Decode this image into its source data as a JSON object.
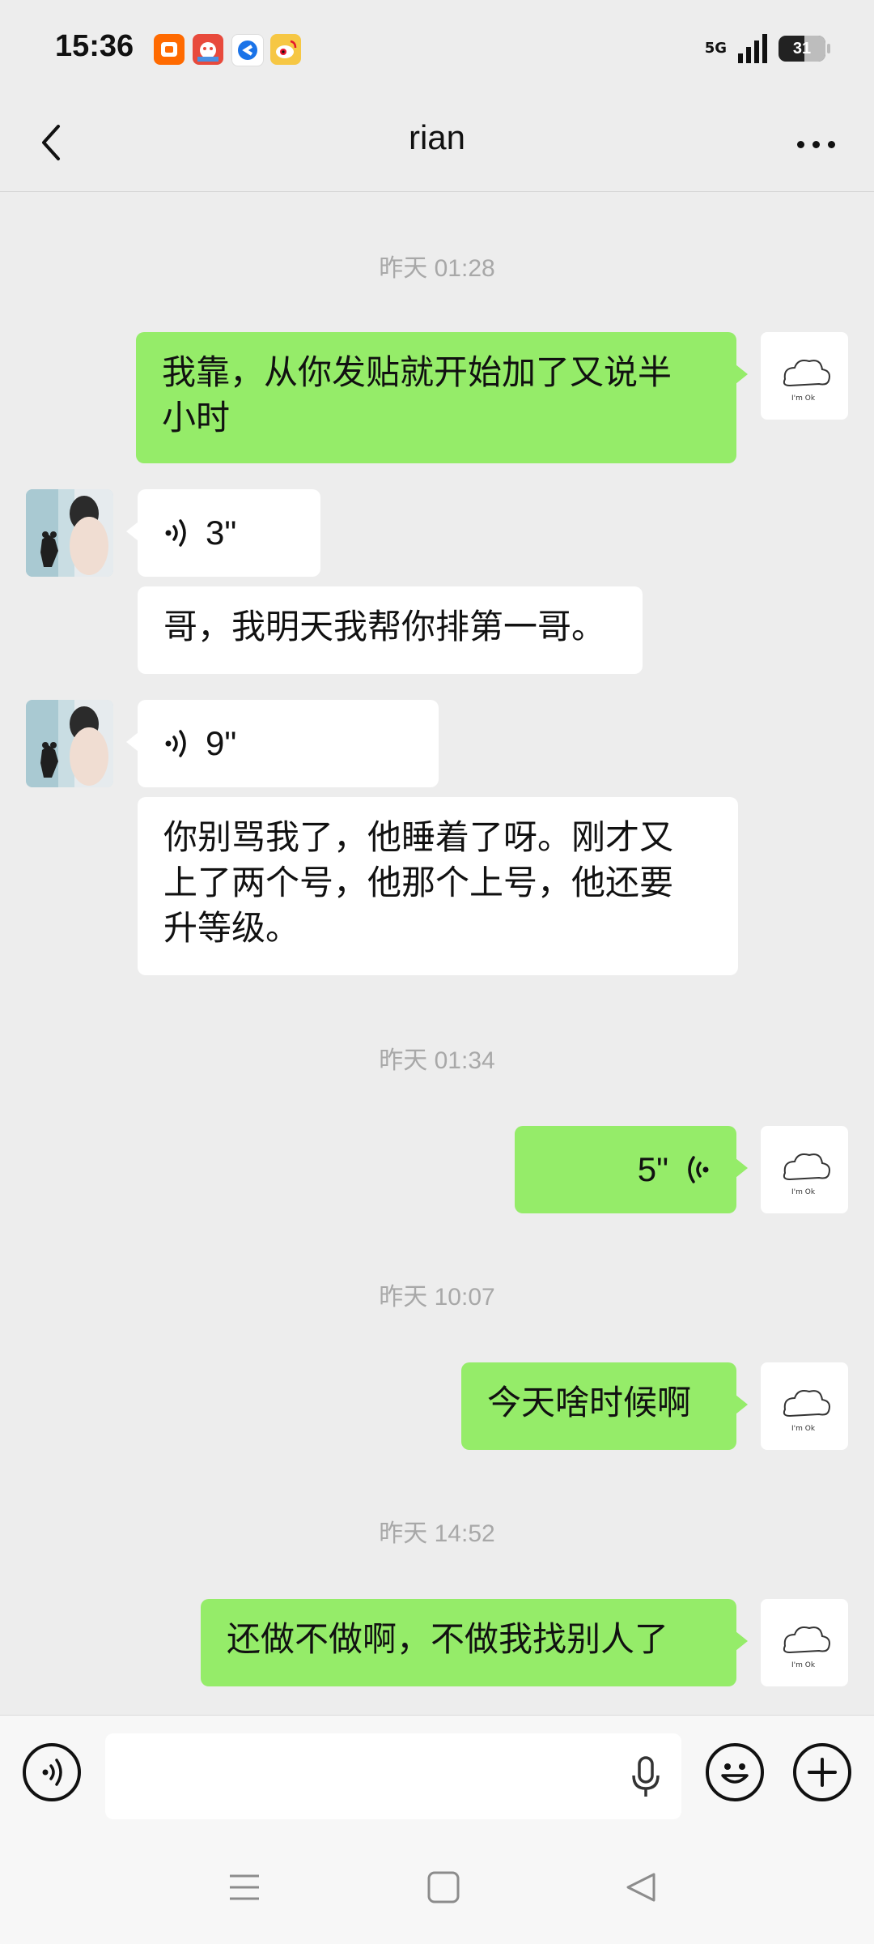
{
  "status_bar": {
    "time": "15:36",
    "network": "5G",
    "battery": "31",
    "notification_icons": [
      "taobao-icon",
      "game-icon",
      "browser-icon",
      "weibo-icon"
    ]
  },
  "header": {
    "title": "rian",
    "back_icon": "chevron-left-icon",
    "more_icon": "more-icon"
  },
  "contact_avatar_note": "",
  "my_avatar": {
    "caption": "I'm Ok"
  },
  "messages": [
    {
      "type": "timestamp",
      "text": "昨天 01:28"
    },
    {
      "type": "text",
      "from": "me",
      "lines": [
        "我靠，从你发贴就开始加了又说半",
        "小时"
      ]
    },
    {
      "type": "voice",
      "from": "them",
      "duration": "3\""
    },
    {
      "type": "text",
      "from": "them",
      "lines": [
        "哥，我明天我帮你排第一哥。"
      ]
    },
    {
      "type": "voice",
      "from": "them",
      "duration": "9\""
    },
    {
      "type": "text",
      "from": "them",
      "lines": [
        "你别骂我了，他睡着了呀。刚才又",
        "上了两个号，他那个上号，他还要",
        "升等级。"
      ]
    },
    {
      "type": "timestamp",
      "text": "昨天 01:34"
    },
    {
      "type": "voice",
      "from": "me",
      "duration": "5\""
    },
    {
      "type": "timestamp",
      "text": "昨天 10:07"
    },
    {
      "type": "text",
      "from": "me",
      "lines": [
        "今天啥时候啊"
      ]
    },
    {
      "type": "timestamp",
      "text": "昨天 14:52"
    },
    {
      "type": "text",
      "from": "me",
      "lines": [
        "还做不做啊，不做我找别人了"
      ]
    }
  ],
  "input_bar": {
    "text_value": "",
    "icons": [
      "voice-mode-icon",
      "microphone-icon",
      "emoji-icon",
      "plus-icon"
    ]
  },
  "colors": {
    "background": "#ededed",
    "my_bubble": "#95ec69",
    "their_bubble": "#ffffff",
    "timestamp": "#a8a8a8"
  }
}
